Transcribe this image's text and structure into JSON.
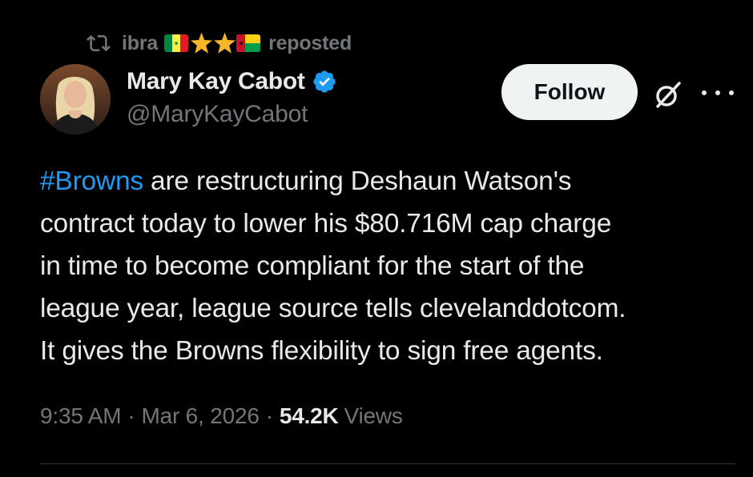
{
  "repost": {
    "user": "ibra",
    "emoji": [
      "senegal-flag",
      "star",
      "star",
      "guinea-bissau-flag"
    ],
    "suffix": "reposted"
  },
  "author": {
    "display_name": "Mary Kay Cabot",
    "handle": "@MaryKayCabot",
    "verified": true,
    "verified_color": "#1d9bf0"
  },
  "actions": {
    "follow_label": "Follow",
    "grok_icon": "grok-icon",
    "more_icon": "more-icon"
  },
  "tweet": {
    "hashtag": "#Browns",
    "line1_rest": " are restructuring Deshaun Watson's",
    "line2": "contract today to lower his $80.716M cap charge",
    "line3": "in time to become compliant for the start of the",
    "line4": "league year, league source tells clevelanddotcom.",
    "line5": "It gives the Browns flexibility to sign free agents."
  },
  "meta": {
    "time": "9:35 AM",
    "separator": "·",
    "date": "Mar 6, 2026",
    "views_count": "54.2K",
    "views_label": "Views"
  },
  "colors": {
    "background": "#000000",
    "text_primary": "#e7e9ea",
    "text_secondary": "#71767b",
    "link": "#1d9bf0",
    "follow_bg": "#eff3f4"
  }
}
